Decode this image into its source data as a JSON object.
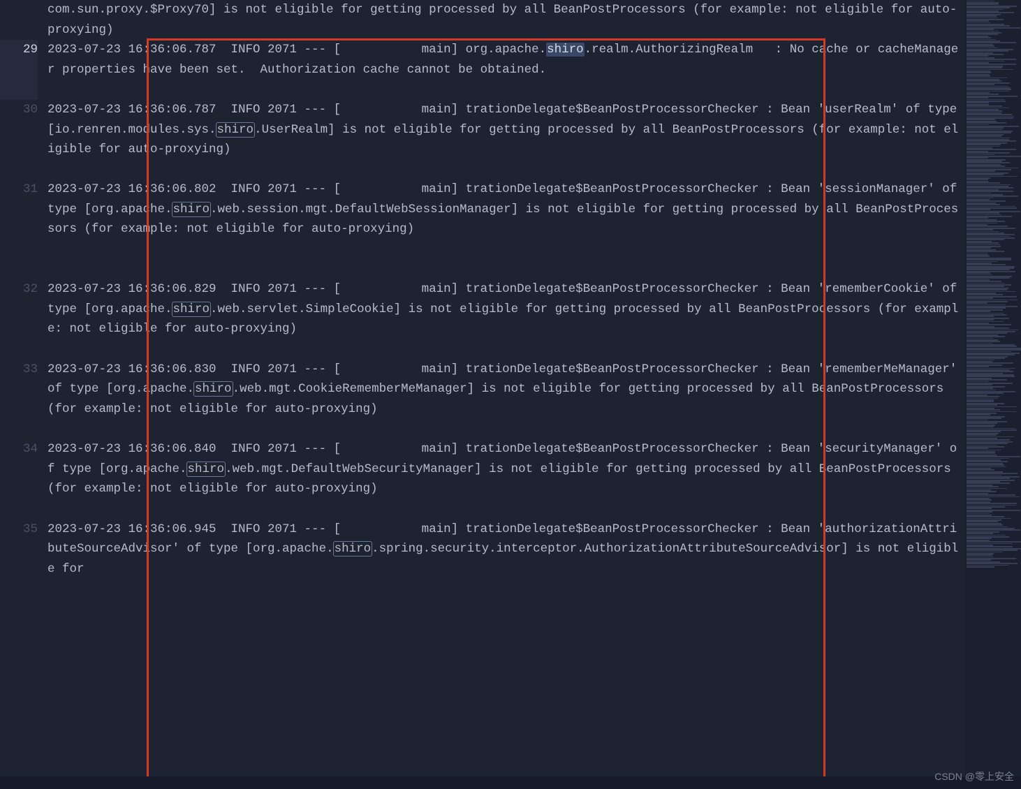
{
  "watermark": "CSDN @零上安全",
  "highlight_word": "shiro",
  "lines": [
    {
      "num": "",
      "segments": [
        {
          "t": "com.sun.proxy.$Proxy70] is not eligible for getting processed by all BeanPostProcessors (for example: not eligible for auto-proxying)"
        }
      ]
    },
    {
      "num": "29",
      "active": true,
      "segments": [
        {
          "t": "2023-07-23 16:36:06.787  INFO 2071 --- [           main] org.apache."
        },
        {
          "t": "shiro",
          "sel": true
        },
        {
          "t": ".realm.AuthorizingRealm   : No cache or cacheManager properties have been set.  Authorization cache cannot be obtained."
        }
      ]
    },
    {
      "num": "30",
      "segments": [
        {
          "t": "2023-07-23 16:36:06.787  INFO 2071 --- [           main] trationDelegate$BeanPostProcessorChecker : Bean 'userRealm' of type [io.renren.modules.sys."
        },
        {
          "t": "shiro",
          "box": true
        },
        {
          "t": ".UserRealm] is not eligible for getting processed by all BeanPostProcessors (for example: not eligible for auto-proxying)"
        }
      ]
    },
    {
      "num": "31",
      "segments": [
        {
          "t": "2023-07-23 16:36:06.802  INFO 2071 --- [           main] trationDelegate$BeanPostProcessorChecker : Bean 'sessionManager' of type [org.apache."
        },
        {
          "t": "shiro",
          "box": true
        },
        {
          "t": ".web.session.mgt.DefaultWebSessionManager] is not eligible for getting processed by all BeanPostProcessors (for example: not eligible for auto-proxying)"
        }
      ]
    },
    {
      "num": "32",
      "segments": [
        {
          "t": "2023-07-23 16:36:06.829  INFO 2071 --- [           main] trationDelegate$BeanPostProcessorChecker : Bean 'rememberCookie' of type [org.apache."
        },
        {
          "t": "shiro",
          "box": true
        },
        {
          "t": ".web.servlet.SimpleCookie] is not eligible for getting processed by all BeanPostProcessors (for example: not eligible for auto-proxying)"
        }
      ]
    },
    {
      "num": "33",
      "segments": [
        {
          "t": "2023-07-23 16:36:06.830  INFO 2071 --- [           main] trationDelegate$BeanPostProcessorChecker : Bean 'rememberMeManager' of type [org.apache."
        },
        {
          "t": "shiro",
          "box": true
        },
        {
          "t": ".web.mgt.CookieRememberMeManager] is not eligible for getting processed by all BeanPostProcessors (for example: not eligible for auto-proxying)"
        }
      ]
    },
    {
      "num": "34",
      "segments": [
        {
          "t": "2023-07-23 16:36:06.840  INFO 2071 --- [           main] trationDelegate$BeanPostProcessorChecker : Bean 'securityManager' of type [org.apache."
        },
        {
          "t": "shiro",
          "box": true
        },
        {
          "t": ".web.mgt.DefaultWebSecurityManager] is not eligible for getting processed by all BeanPostProcessors (for example: not eligible for auto-proxying)"
        }
      ]
    },
    {
      "num": "35",
      "segments": [
        {
          "t": "2023-07-23 16:36:06.945  INFO 2071 --- [           main] trationDelegate$BeanPostProcessorChecker : Bean 'authorizationAttributeSourceAdvisor' of type [org.apache."
        },
        {
          "t": "shiro",
          "box": true
        },
        {
          "t": ".spring.security.interceptor.AuthorizationAttributeSourceAdvisor] is not eligible for"
        }
      ]
    }
  ],
  "visual_row_heights": [
    2,
    3,
    4,
    5,
    4,
    4,
    4,
    4,
    4
  ],
  "minimap_rows": 340
}
